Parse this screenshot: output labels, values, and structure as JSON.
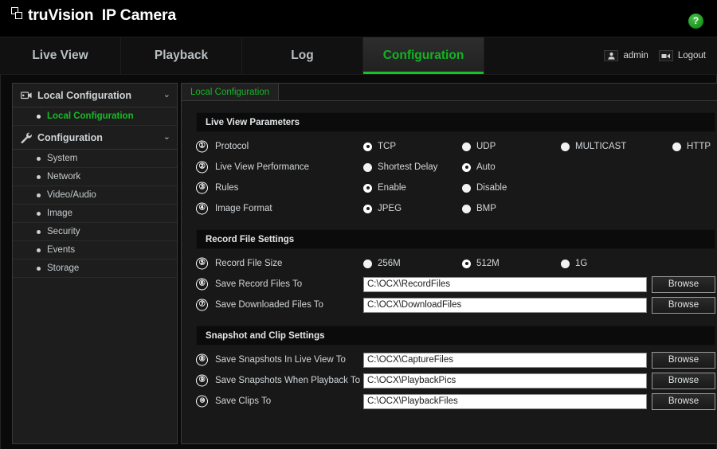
{
  "header": {
    "brand_name": "truVision",
    "brand_model": "IP Camera",
    "logo_icon": "overlapping-squares-logo",
    "help_icon": "help-question-icon",
    "help_label": "?"
  },
  "nav": {
    "tabs": [
      {
        "label": "Live View",
        "active": false
      },
      {
        "label": "Playback",
        "active": false
      },
      {
        "label": "Log",
        "active": false
      },
      {
        "label": "Configuration",
        "active": true
      }
    ],
    "user": {
      "user_icon": "user-avatar-icon",
      "user_label": "admin",
      "logout_icon": "logout-arrow-icon",
      "logout_label": "Logout"
    }
  },
  "sidebar": {
    "groups": [
      {
        "title": "Local Configuration",
        "icon": "camera-config-icon",
        "chevron": "⌄",
        "items": [
          {
            "label": "Local Configuration",
            "selected": true
          }
        ]
      },
      {
        "title": "Configuration",
        "icon": "wrench-icon",
        "chevron": "⌄",
        "items": [
          {
            "label": "System",
            "selected": false
          },
          {
            "label": "Network",
            "selected": false
          },
          {
            "label": "Video/Audio",
            "selected": false
          },
          {
            "label": "Image",
            "selected": false
          },
          {
            "label": "Security",
            "selected": false
          },
          {
            "label": "Events",
            "selected": false
          },
          {
            "label": "Storage",
            "selected": false
          }
        ]
      }
    ]
  },
  "content": {
    "tab_label": "Local Configuration",
    "sections": [
      {
        "title": "Live View Parameters",
        "rows": [
          {
            "marker": "①",
            "label": "Protocol",
            "type": "radio",
            "options": [
              {
                "label": "TCP",
                "selected": true
              },
              {
                "label": "UDP",
                "selected": false
              },
              {
                "label": "MULTICAST",
                "selected": false
              },
              {
                "label": "HTTP",
                "selected": false
              }
            ]
          },
          {
            "marker": "②",
            "label": "Live View Performance",
            "type": "radio",
            "options": [
              {
                "label": "Shortest Delay",
                "selected": false
              },
              {
                "label": "Auto",
                "selected": true
              }
            ]
          },
          {
            "marker": "③",
            "label": "Rules",
            "type": "radio",
            "options": [
              {
                "label": "Enable",
                "selected": true
              },
              {
                "label": "Disable",
                "selected": false
              }
            ]
          },
          {
            "marker": "④",
            "label": "Image Format",
            "type": "radio",
            "options": [
              {
                "label": "JPEG",
                "selected": true
              },
              {
                "label": "BMP",
                "selected": false
              }
            ]
          }
        ]
      },
      {
        "title": "Record File Settings",
        "rows": [
          {
            "marker": "⑤",
            "label": "Record File Size",
            "type": "radio",
            "options": [
              {
                "label": "256M",
                "selected": false
              },
              {
                "label": "512M",
                "selected": true
              },
              {
                "label": "1G",
                "selected": false
              }
            ]
          },
          {
            "marker": "⑥",
            "label": "Save Record Files To",
            "type": "path",
            "value": "C:\\OCX\\RecordFiles",
            "button": "Browse"
          },
          {
            "marker": "⑦",
            "label": "Save Downloaded Files To",
            "type": "path",
            "value": "C:\\OCX\\DownloadFiles",
            "button": "Browse"
          }
        ]
      },
      {
        "title": "Snapshot and Clip Settings",
        "rows": [
          {
            "marker": "⑧",
            "label": "Save Snapshots In Live View To",
            "type": "path",
            "value": "C:\\OCX\\CaptureFiles",
            "button": "Browse"
          },
          {
            "marker": "⑨",
            "label": "Save Snapshots When Playback To",
            "type": "path",
            "value": "C:\\OCX\\PlaybackPics",
            "button": "Browse"
          },
          {
            "marker": "⑩",
            "label": "Save Clips To",
            "type": "path",
            "value": "C:\\OCX\\PlaybackFiles",
            "button": "Browse"
          }
        ]
      }
    ]
  },
  "colors": {
    "accent_green": "#16c12a",
    "panel_bg": "#181818",
    "sidebar_bg": "#1d1d1d"
  }
}
